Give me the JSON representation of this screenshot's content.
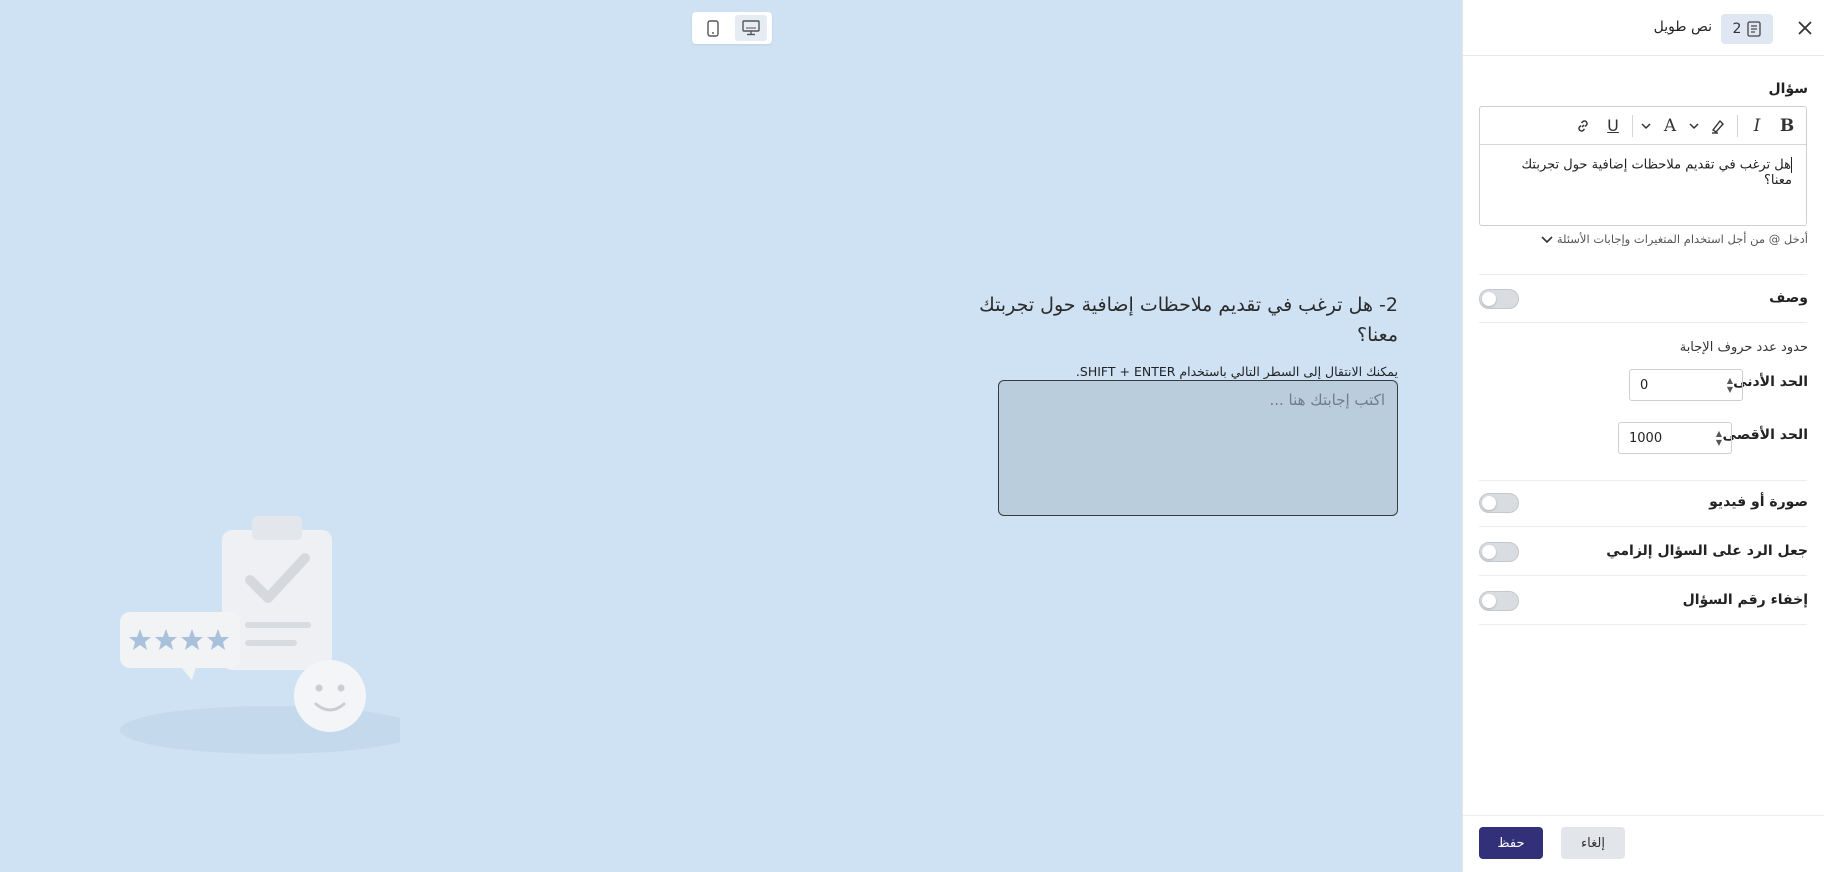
{
  "preview": {
    "question_title": "2- هل ترغب في تقديم ملاحظات إضافية حول تجربتك معنا؟",
    "hint": "يمكنك الانتقال إلى السطر التالي باستخدام SHIFT + ENTER.",
    "answer_placeholder": "اكتب إجابتك هنا ...",
    "device_buttons": [
      "mobile-icon",
      "desktop-icon"
    ]
  },
  "panel": {
    "question_number": "2",
    "question_type": "نص طويل",
    "question_label": "سؤال",
    "question_text": "هل ترغب في تقديم ملاحظات إضافية حول تجربتك معنا؟",
    "vars_hint": "أدخل @ من أجل استخدام المتغيرات وإجابات الأسئلة",
    "toolbar": {
      "bold": "B",
      "italic": "I",
      "underline": "U",
      "font_size": "A"
    },
    "description_label": "وصف",
    "limits_label": "حدود عدد حروف الإجابة",
    "min_label": "الحد الأدنى",
    "min_value": "0",
    "max_label": "الحد الأقصى",
    "max_value": "1000",
    "media_label": "صورة أو فيديو",
    "required_label": "جعل الرد على السؤال إلزامي",
    "hide_number_label": "إخفاء رقم السؤال",
    "save_label": "حفظ",
    "cancel_label": "إلغاء"
  },
  "colors": {
    "canvas_bg": "#cfe2f3",
    "primary": "#33307a",
    "answer_bg": "#b9cddd"
  }
}
